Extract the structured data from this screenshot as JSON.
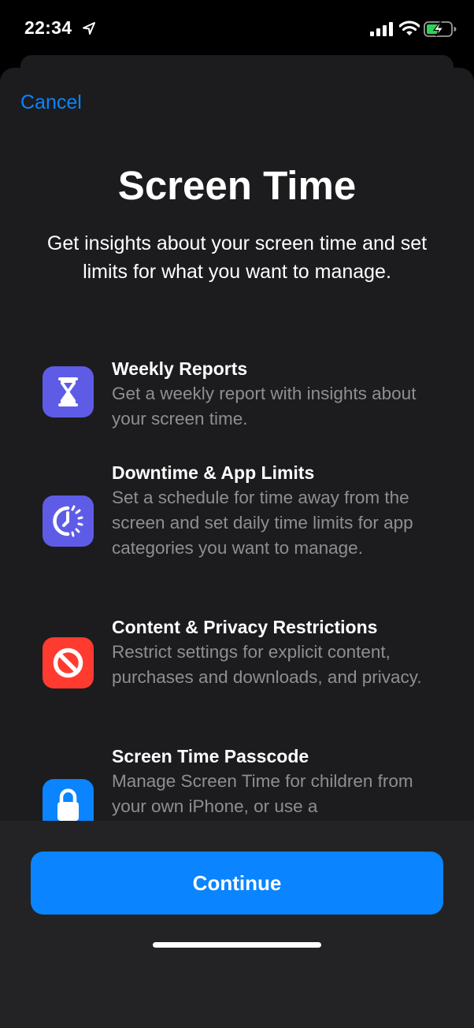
{
  "status_bar": {
    "time": "22:34",
    "icons": [
      "location-arrow-icon",
      "cellular-signal-icon",
      "wifi-icon",
      "battery-charging-icon"
    ]
  },
  "header": {
    "cancel_label": "Cancel"
  },
  "main": {
    "title": "Screen Time",
    "subtitle": "Get insights about your screen time and set limits for what you want to manage.",
    "features": [
      {
        "icon": "hourglass-icon",
        "icon_color": "#5e5ce6",
        "title": "Weekly Reports",
        "description": "Get a weekly report with insights about your screen time."
      },
      {
        "icon": "downtime-icon",
        "icon_color": "#5e5ce6",
        "title": "Downtime & App Limits",
        "description": "Set a schedule for time away from the screen and set daily time limits for app categories you want to manage."
      },
      {
        "icon": "restriction-icon",
        "icon_color": "#ff3b30",
        "title": "Content & Privacy Restrictions",
        "description": "Restrict settings for explicit content, purchases and downloads, and privacy."
      },
      {
        "icon": "lock-icon",
        "icon_color": "#0a84ff",
        "title": "Screen Time Passcode",
        "description": "Manage Screen Time for children from your own iPhone, or use a"
      }
    ]
  },
  "footer": {
    "continue_label": "Continue"
  },
  "colors": {
    "accent": "#0a84ff",
    "sheet_background": "#1c1c1e",
    "secondary_text": "#8e8e93"
  }
}
